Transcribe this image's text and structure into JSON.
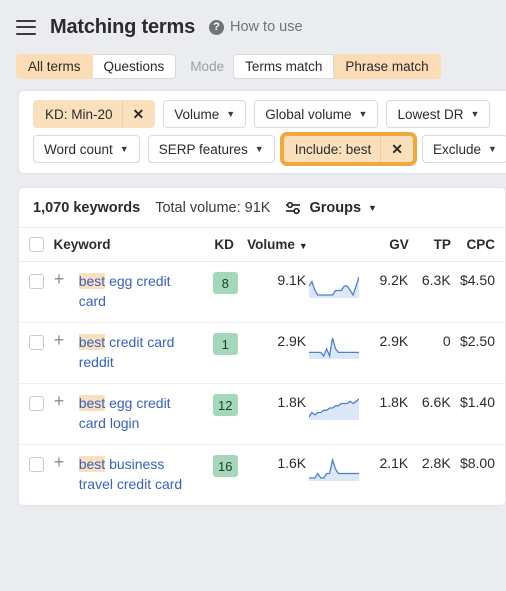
{
  "header": {
    "menu_icon": "hamburger-icon",
    "title": "Matching terms",
    "help_icon": "question-mark-icon",
    "help_glyph": "?",
    "help_label": "How to use"
  },
  "modebar": {
    "all_terms": "All terms",
    "questions": "Questions",
    "mode_label": "Mode",
    "terms_match": "Terms match",
    "phrase_match": "Phrase match",
    "active_terms_tab": "All terms",
    "active_mode": "Phrase match"
  },
  "filters": {
    "row1": [
      {
        "label": "KD: Min-20",
        "applied": true,
        "has_caret": false,
        "close_glyph": "✕"
      },
      {
        "label": "Volume",
        "applied": false,
        "has_caret": true
      },
      {
        "label": "Global volume",
        "applied": false,
        "has_caret": true
      },
      {
        "label": "Lowest DR",
        "applied": false,
        "has_caret": true
      }
    ],
    "row2": [
      {
        "label": "Word count",
        "applied": false,
        "has_caret": true
      },
      {
        "label": "SERP features",
        "applied": false,
        "has_caret": true
      },
      {
        "label": "Include: best",
        "applied": true,
        "focused": true,
        "has_caret": false,
        "close_glyph": "✕"
      },
      {
        "label": "Exclude",
        "applied": false,
        "has_caret": true
      }
    ]
  },
  "summary": {
    "keyword_count": "1,070 keywords",
    "total_volume": "Total volume: 91K",
    "groups_icon": "sliders-icon",
    "groups_label": "Groups",
    "caret": "▾"
  },
  "table": {
    "columns": {
      "keyword": "Keyword",
      "kd": "KD",
      "volume": "Volume",
      "gv": "GV",
      "tp": "TP",
      "cpc": "CPC"
    },
    "sorted_by": "Volume",
    "sort_caret": "▾",
    "add_glyph": "+",
    "rows": [
      {
        "keyword_highlight": "best",
        "keyword_rest": " egg credit card",
        "kd": "8",
        "volume": "9.1K",
        "gv": "9.2K",
        "tp": "6.3K",
        "cpc": "$4.50",
        "spark": [
          5,
          6,
          4,
          3,
          3,
          3,
          3,
          3,
          3,
          4,
          4,
          4,
          5,
          5,
          4,
          3,
          5,
          7
        ]
      },
      {
        "keyword_highlight": "best",
        "keyword_rest": " credit card reddit",
        "kd": "1",
        "volume": "2.9K",
        "gv": "2.9K",
        "tp": "0",
        "cpc": "$2.50",
        "spark": [
          5,
          5,
          5,
          5,
          5,
          4,
          6,
          4,
          9,
          6,
          5,
          5,
          5,
          5,
          5,
          5,
          5,
          5
        ]
      },
      {
        "keyword_highlight": "best",
        "keyword_rest": " egg credit card login",
        "kd": "12",
        "volume": "1.8K",
        "gv": "1.8K",
        "tp": "6.6K",
        "cpc": "$1.40",
        "spark": [
          1,
          3,
          2,
          3,
          3,
          4,
          4,
          5,
          5,
          6,
          6,
          7,
          7,
          7,
          8,
          7,
          8,
          9
        ]
      },
      {
        "keyword_highlight": "best",
        "keyword_rest": " business travel credit card",
        "kd": "16",
        "volume": "1.6K",
        "gv": "2.1K",
        "tp": "2.8K",
        "cpc": "$8.00",
        "spark": [
          4,
          4,
          4,
          5,
          4,
          4,
          5,
          5,
          8,
          6,
          5,
          5,
          5,
          5,
          5,
          5,
          5,
          5
        ]
      }
    ]
  },
  "colors": {
    "page_bg": "#ebecef",
    "card_bg": "#ffffff",
    "accent_peach": "#fae0bd",
    "accent_orange": "#f0a93c",
    "kd_green": "#a5d8ba",
    "link_blue": "#3660c4",
    "spark_line": "#4a7fd4"
  }
}
